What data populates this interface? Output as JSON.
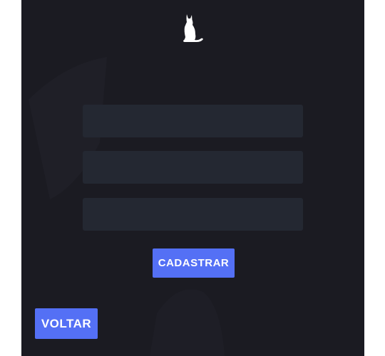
{
  "app": {
    "logo_icon": "cat-silhouette-icon"
  },
  "form": {
    "fields": [
      {
        "value": "",
        "placeholder": ""
      },
      {
        "value": "",
        "placeholder": ""
      },
      {
        "value": "",
        "placeholder": ""
      }
    ],
    "register_label": "CADASTRAR"
  },
  "nav": {
    "back_label": "VOLTAR"
  },
  "colors": {
    "background": "#1b1b22",
    "field": "#242832",
    "accent": "#5470f5",
    "text": "#ffffff"
  }
}
